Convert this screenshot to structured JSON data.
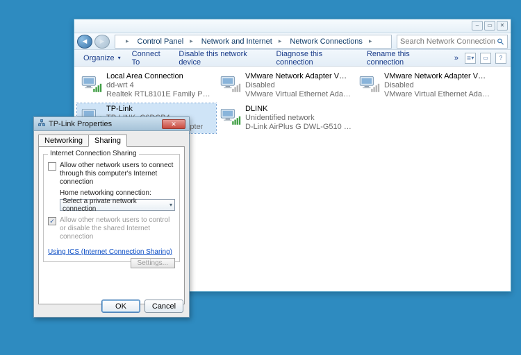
{
  "window": {
    "breadcrumbs": [
      {
        "label": "Control Panel"
      },
      {
        "label": "Network and Internet"
      },
      {
        "label": "Network Connections"
      }
    ],
    "search_placeholder": "Search Network Connections",
    "toolbar": {
      "organize": "Organize",
      "connect_to": "Connect To",
      "disable": "Disable this network device",
      "diagnose": "Diagnose this connection",
      "rename": "Rename this connection",
      "more": "»"
    },
    "connections": [
      {
        "name": "Local Area Connection",
        "status": "dd-wrt 4",
        "device": "Realtek RTL8101E Family PCI-E Fa...",
        "bars": "green"
      },
      {
        "name": "VMware Network Adapter VMnet1",
        "status": "Disabled",
        "device": "VMware Virtual Ethernet Adapter ...",
        "bars": "grey"
      },
      {
        "name": "VMware Network Adapter VMnet8",
        "status": "Disabled",
        "device": "VMware Virtual Ethernet Adapter ...",
        "bars": "grey"
      },
      {
        "name": "TP-Link",
        "status": "TP-LINK_C6DCB4",
        "device": "TP-LINK Wireless N Adapter",
        "bars": "green",
        "selected": true
      },
      {
        "name": "DLINK",
        "status": "Unidentified network",
        "device": "D-Link AirPlus G DWL-G510 Wirel...",
        "bars": "green"
      }
    ]
  },
  "dialog": {
    "title": "TP-Link Properties",
    "tabs": {
      "networking": "Networking",
      "sharing": "Sharing"
    },
    "group_title": "Internet Connection Sharing",
    "allow_other": "Allow other network users to connect through this computer's Internet connection",
    "home_label": "Home networking connection:",
    "select_value": "Select a private network connection",
    "allow_control": "Allow other network users to control or disable the shared Internet connection",
    "link": "Using ICS (Internet Connection Sharing)",
    "settings": "Settings...",
    "ok": "OK",
    "cancel": "Cancel"
  }
}
